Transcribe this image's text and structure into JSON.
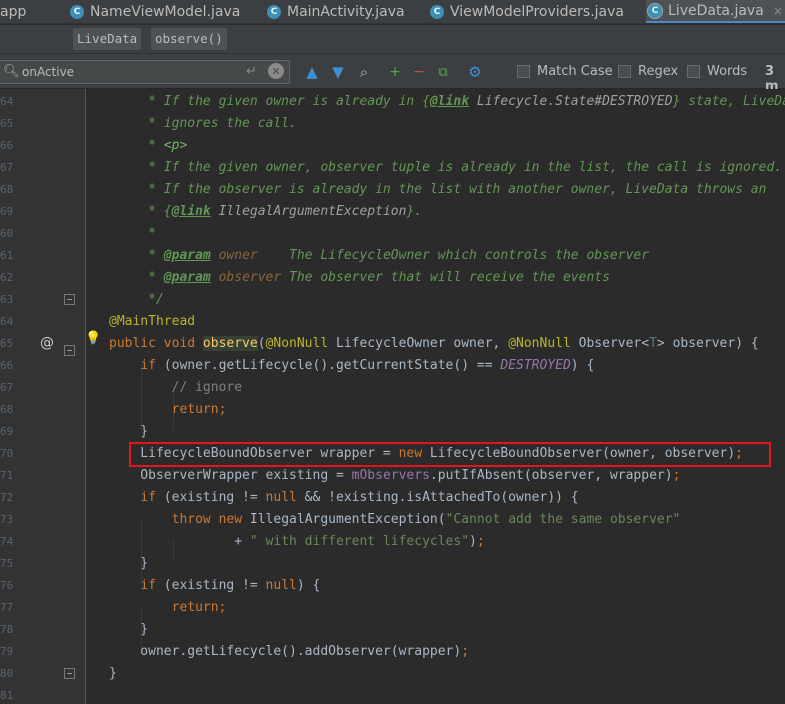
{
  "tabs": [
    {
      "label": "app",
      "icon": "folder-icon"
    },
    {
      "label": "NameViewModel.java",
      "icon": "class-icon"
    },
    {
      "label": "MainActivity.java",
      "icon": "class-icon"
    },
    {
      "label": "ViewModelProviders.java",
      "icon": "class-icon"
    },
    {
      "label": "LiveData.java",
      "icon": "class-icon",
      "active": true
    }
  ],
  "tab_icon_glyph": "C",
  "tab_close_glyph": "×",
  "breadcrumbs": [
    "LiveData",
    "observe()"
  ],
  "search": {
    "value": "onActive",
    "options": [
      "Match Case",
      "Regex",
      "Words"
    ],
    "result_count": "3 m"
  },
  "code": {
    "lines": [
      {
        "num": "64",
        "tokens": [
          [
            "cmt",
            "     * If the given owner is already in "
          ],
          [
            "cmt",
            "{"
          ],
          [
            "cmt-tag",
            "@link"
          ],
          [
            "cmt-ref",
            " Lifecycle.State"
          ],
          [
            "cmt-ref",
            "#DESTROYED"
          ],
          [
            "cmt",
            "} state, LiveData"
          ]
        ]
      },
      {
        "num": "65",
        "tokens": [
          [
            "cmt",
            "     * ignores the call."
          ]
        ]
      },
      {
        "num": "66",
        "tokens": [
          [
            "cmt",
            "     * "
          ],
          [
            "cmt-html",
            "<p>"
          ]
        ]
      },
      {
        "num": "67",
        "tokens": [
          [
            "cmt",
            "     * If the given owner, observer tuple is already in the list, the call is ignored."
          ]
        ]
      },
      {
        "num": "68",
        "tokens": [
          [
            "cmt",
            "     * If the observer is already in the list with another owner, LiveData throws an"
          ]
        ]
      },
      {
        "num": "69",
        "tokens": [
          [
            "cmt",
            "     * {"
          ],
          [
            "cmt-tag",
            "@link"
          ],
          [
            "cmt-ref",
            " IllegalArgumentException"
          ],
          [
            "cmt",
            "}."
          ]
        ]
      },
      {
        "num": "60",
        "tokens": [
          [
            "cmt",
            "     *"
          ]
        ]
      },
      {
        "num": "61",
        "tokens": [
          [
            "cmt",
            "     * "
          ],
          [
            "cmt-tag",
            "@param"
          ],
          [
            "cmt-param",
            " owner"
          ],
          [
            "cmt",
            "    The LifecycleOwner which controls the observer"
          ]
        ]
      },
      {
        "num": "62",
        "tokens": [
          [
            "cmt",
            "     * "
          ],
          [
            "cmt-tag",
            "@param"
          ],
          [
            "cmt-param",
            " observer"
          ],
          [
            "cmt",
            " The observer that will receive the events"
          ]
        ]
      },
      {
        "num": "63",
        "tokens": [
          [
            "cmt",
            "     */"
          ]
        ]
      },
      {
        "num": "64",
        "tokens": [
          [
            "ann",
            "@MainThread"
          ]
        ]
      },
      {
        "num": "65",
        "tokens": [
          [
            "kw",
            "public void "
          ],
          [
            "fn-decl",
            "observe"
          ],
          [
            "plain",
            "("
          ],
          [
            "ann",
            "@NonNull"
          ],
          [
            "plain",
            " LifecycleOwner owner, "
          ],
          [
            "ann",
            "@NonNull"
          ],
          [
            "plain",
            " Observer<"
          ],
          [
            "tparam",
            "T"
          ],
          [
            "plain",
            "> observer) {"
          ]
        ]
      },
      {
        "num": "66",
        "tokens": [
          [
            "plain",
            "    "
          ],
          [
            "kw",
            "if"
          ],
          [
            "plain",
            " (owner.getLifecycle().getCurrentState() == "
          ],
          [
            "const",
            "DESTROYED"
          ],
          [
            "plain",
            ") {"
          ]
        ]
      },
      {
        "num": "67",
        "tokens": [
          [
            "linecmt",
            "        // ignore"
          ]
        ]
      },
      {
        "num": "68",
        "tokens": [
          [
            "plain",
            "        "
          ],
          [
            "kw",
            "return;"
          ]
        ]
      },
      {
        "num": "69",
        "tokens": [
          [
            "plain",
            "    }"
          ]
        ]
      },
      {
        "num": "70",
        "tokens": [
          [
            "plain",
            "    LifecycleBoundObserver wrapper = "
          ],
          [
            "kw",
            "new"
          ],
          [
            "plain",
            " LifecycleBoundObserver(owner, observer)"
          ],
          [
            "kw",
            ";"
          ]
        ]
      },
      {
        "num": "71",
        "tokens": [
          [
            "plain",
            "    ObserverWrapper existing = "
          ],
          [
            "field",
            "mObservers"
          ],
          [
            "plain",
            ".putIfAbsent(observer, wrapper)"
          ],
          [
            "kw",
            ";"
          ]
        ]
      },
      {
        "num": "72",
        "tokens": [
          [
            "plain",
            "    "
          ],
          [
            "kw",
            "if"
          ],
          [
            "plain",
            " (existing != "
          ],
          [
            "kw",
            "null"
          ],
          [
            "plain",
            " && !existing.isAttachedTo(owner)) {"
          ]
        ]
      },
      {
        "num": "73",
        "tokens": [
          [
            "plain",
            "        "
          ],
          [
            "kw",
            "throw new"
          ],
          [
            "plain",
            " IllegalArgumentException("
          ],
          [
            "str",
            "\"Cannot add the same observer\""
          ]
        ]
      },
      {
        "num": "74",
        "tokens": [
          [
            "plain",
            "                + "
          ],
          [
            "str",
            "\" with different lifecycles\""
          ],
          [
            "plain",
            ")"
          ],
          [
            "kw",
            ";"
          ]
        ]
      },
      {
        "num": "75",
        "tokens": [
          [
            "plain",
            "    }"
          ]
        ]
      },
      {
        "num": "76",
        "tokens": [
          [
            "plain",
            "    "
          ],
          [
            "kw",
            "if"
          ],
          [
            "plain",
            " (existing != "
          ],
          [
            "kw",
            "null"
          ],
          [
            "plain",
            ") {"
          ]
        ]
      },
      {
        "num": "77",
        "tokens": [
          [
            "plain",
            "        "
          ],
          [
            "kw",
            "return;"
          ]
        ]
      },
      {
        "num": "78",
        "tokens": [
          [
            "plain",
            "    }"
          ]
        ]
      },
      {
        "num": "79",
        "tokens": [
          [
            "plain",
            "    owner.getLifecycle().addObserver(wrapper)"
          ],
          [
            "kw",
            ";"
          ]
        ]
      },
      {
        "num": "80",
        "tokens": [
          [
            "plain",
            "}"
          ]
        ]
      },
      {
        "num": "81",
        "tokens": []
      }
    ]
  },
  "gutter_icons": {
    "override": "@",
    "bulb": "💡"
  },
  "colors": {
    "highlight_box": "#e0161b",
    "tab_active_underline": "#4a88c7",
    "keyword": "#cc7832",
    "comment": "#629755",
    "annotation": "#bbb529"
  }
}
